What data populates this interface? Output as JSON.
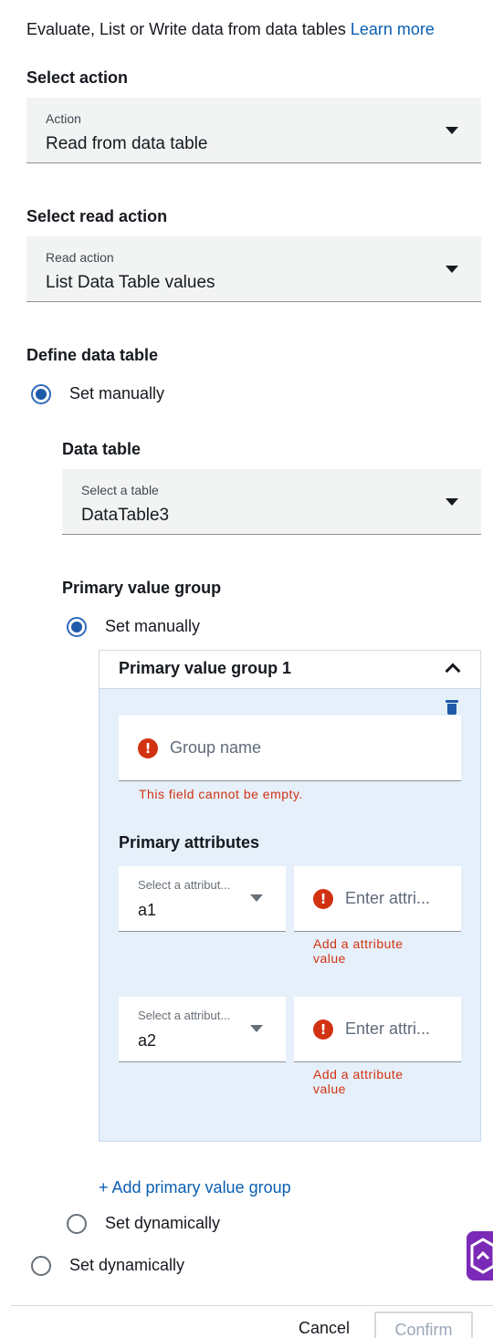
{
  "intro": {
    "text": "Evaluate, List or Write data from data tables",
    "link": "Learn more"
  },
  "select_action": {
    "title": "Select action",
    "label": "Action",
    "value": "Read from data table"
  },
  "select_read_action": {
    "title": "Select read action",
    "label": "Read action",
    "value": "List Data Table values"
  },
  "define_data_table": {
    "title": "Define data table",
    "set_manually": "Set manually",
    "set_dynamically": "Set dynamically",
    "data_table": {
      "title": "Data table",
      "label": "Select a table",
      "value": "DataTable3"
    },
    "primary_value_group": {
      "title": "Primary value group",
      "set_manually": "Set manually",
      "set_dynamically": "Set dynamically",
      "group": {
        "title": "Primary value group 1",
        "group_name_placeholder": "Group name",
        "group_name_error": "This field cannot be empty.",
        "attributes_title": "Primary attributes",
        "attributes": [
          {
            "select_label": "Select a attribut...",
            "select_value": "a1",
            "value_placeholder": "Enter attri...",
            "error_line1": "Add a attribute",
            "error_line2": "value"
          },
          {
            "select_label": "Select a attribut...",
            "select_value": "a2",
            "value_placeholder": "Enter attri...",
            "error_line1": "Add a attribute",
            "error_line2": "value"
          }
        ]
      },
      "add_group_link": "+ Add primary value group"
    }
  },
  "footer": {
    "cancel": "Cancel",
    "confirm": "Confirm"
  },
  "icons": {
    "dropdown": "caret-down-icon",
    "collapse": "chevron-up-icon",
    "delete": "trash-icon",
    "error": "exclamation-circle-icon",
    "assistant": "assistant-logo-icon"
  },
  "colors": {
    "link": "#0b5fb2",
    "error": "#d13212",
    "radio_selected": "#1f5aa8",
    "group_background": "#e6f0fa",
    "assistant": "#7b2ab8"
  }
}
